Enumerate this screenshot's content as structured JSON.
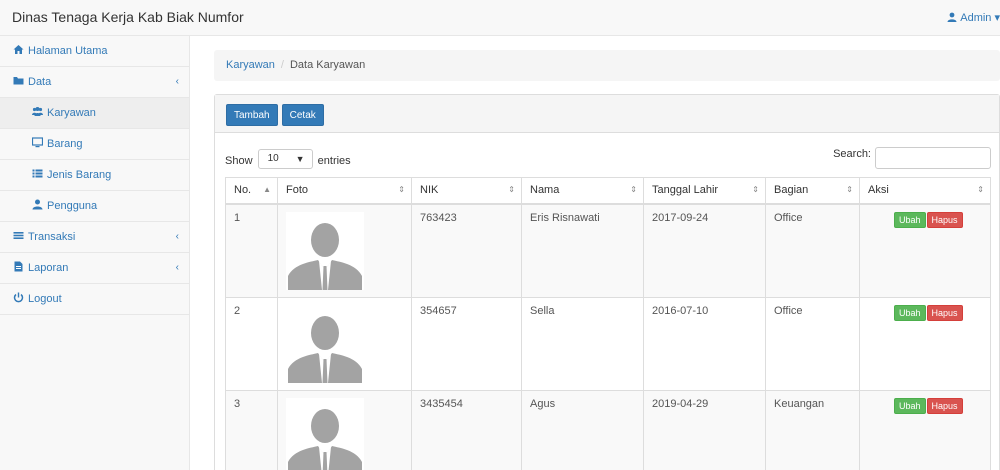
{
  "navbar": {
    "brand": "Dinas Tenaga Kerja Kab Biak Numfor",
    "user": "Admin"
  },
  "sidebar": {
    "items": [
      {
        "label": "Halaman Utama",
        "icon": "home-icon"
      },
      {
        "label": "Data",
        "icon": "folder-icon"
      },
      {
        "label": "Karyawan",
        "icon": "users-icon"
      },
      {
        "label": "Barang",
        "icon": "desktop-icon"
      },
      {
        "label": "Jenis Barang",
        "icon": "list-icon"
      },
      {
        "label": "Pengguna",
        "icon": "user-icon"
      },
      {
        "label": "Transaksi",
        "icon": "bars-icon"
      },
      {
        "label": "Laporan",
        "icon": "file-icon"
      },
      {
        "label": "Logout",
        "icon": "power-icon"
      }
    ]
  },
  "breadcrumb": {
    "parent": "Karyawan",
    "current": "Data Karyawan"
  },
  "panel": {
    "add_button": "Tambah",
    "print_button": "Cetak"
  },
  "datatable": {
    "show_label": "Show",
    "entries_value": "10",
    "entries_label": "entries",
    "search_label": "Search:",
    "columns": [
      "No.",
      "Foto",
      "NIK",
      "Nama",
      "Tanggal Lahir",
      "Bagian",
      "Aksi"
    ],
    "rows": [
      {
        "no": "1",
        "nik": "763423",
        "nama": "Eris Risnawati",
        "tanggal_lahir": "2017-09-24",
        "bagian": "Office"
      },
      {
        "no": "2",
        "nik": "354657",
        "nama": "Sella",
        "tanggal_lahir": "2016-07-10",
        "bagian": "Office"
      },
      {
        "no": "3",
        "nik": "3435454",
        "nama": "Agus",
        "tanggal_lahir": "2019-04-29",
        "bagian": "Keuangan"
      }
    ],
    "edit_label": "Ubah",
    "delete_label": "Hapus"
  }
}
